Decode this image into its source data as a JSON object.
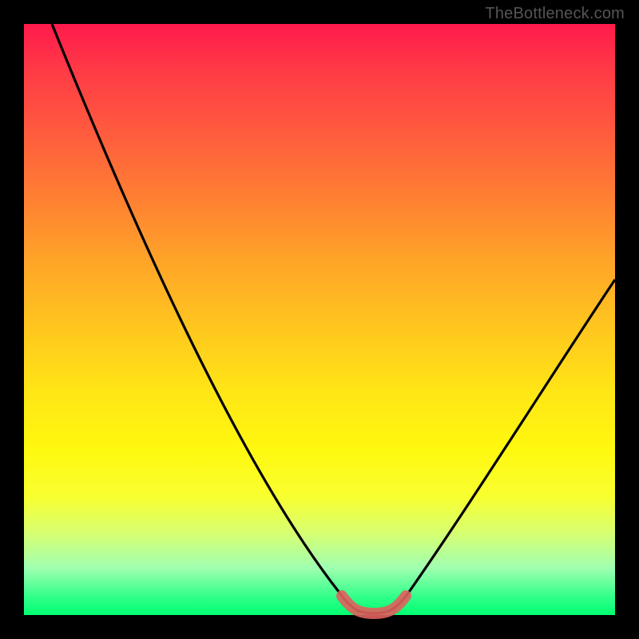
{
  "watermark": "TheBottleneck.com",
  "chart_data": {
    "type": "line",
    "title": "",
    "xlabel": "",
    "ylabel": "",
    "x": [
      0.0,
      0.05,
      0.1,
      0.15,
      0.2,
      0.25,
      0.3,
      0.35,
      0.4,
      0.45,
      0.5,
      0.55,
      0.575,
      0.6,
      0.625,
      0.65,
      0.7,
      0.75,
      0.8,
      0.85,
      0.9,
      0.95,
      1.0
    ],
    "values": [
      1.0,
      0.9,
      0.79,
      0.68,
      0.57,
      0.46,
      0.35,
      0.25,
      0.16,
      0.08,
      0.03,
      0.005,
      0.0,
      0.0,
      0.0,
      0.005,
      0.03,
      0.09,
      0.17,
      0.26,
      0.36,
      0.46,
      0.56
    ],
    "xlim": [
      0,
      1
    ],
    "ylim": [
      0,
      1
    ],
    "green_band": {
      "x_start": 0.55,
      "x_end": 0.65,
      "y": 0.0
    }
  }
}
